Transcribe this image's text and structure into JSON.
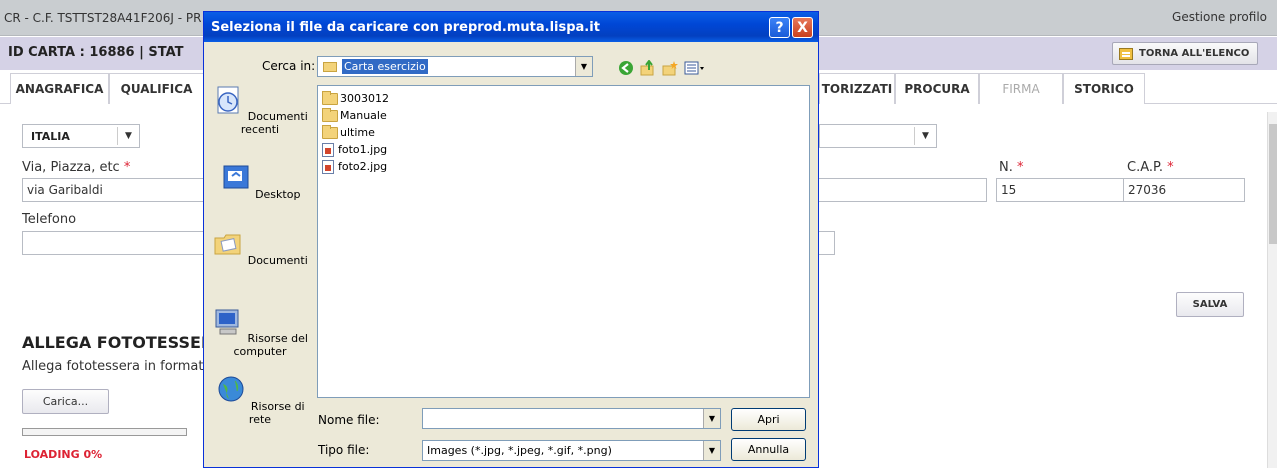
{
  "page": {
    "top_title": "CR - C.F. TSTTST28A41F206J - PR",
    "profile_link": "Gestione profilo",
    "id_bar": "ID CARTA : 16886   |   STAT",
    "back_button": "TORNA ALL'ELENCO",
    "tabs": [
      {
        "label": "ANAGRAFICA",
        "disabled": false
      },
      {
        "label": "QUALIFICA",
        "disabled": false
      },
      {
        "label": "TORIZZATI",
        "disabled": false
      },
      {
        "label": "PROCURA",
        "disabled": false
      },
      {
        "label": "FIRMA",
        "disabled": true
      },
      {
        "label": "STORICO",
        "disabled": false
      }
    ],
    "country_select": "ITALIA",
    "via_label": "Via, Piazza, etc",
    "via_value": "via Garibaldi",
    "numero_label": "N.",
    "numero_value": "15",
    "cap_label": "C.A.P.",
    "cap_value": "27036",
    "telefono_label": "Telefono",
    "telefono_value": "",
    "required_mark": "*",
    "save_button": "SALVA",
    "photo_heading": "ALLEGA FOTOTESSERA",
    "photo_desc": "Allega fototessera in formato",
    "upload_button": "Carica...",
    "loading": "LOADING 0%",
    "progress": 0
  },
  "dialog": {
    "title": "Seleziona il file da caricare con preprod.muta.lispa.it",
    "look_in_label": "Cerca in:",
    "look_in_value": "Carta esercizio",
    "places": [
      "Documenti recenti",
      "Desktop",
      "Documenti",
      "Risorse del computer",
      "Risorse di rete"
    ],
    "files": [
      {
        "name": "3003012",
        "type": "folder"
      },
      {
        "name": "Manuale",
        "type": "folder"
      },
      {
        "name": "ultime",
        "type": "folder"
      },
      {
        "name": "foto1.jpg",
        "type": "jpg"
      },
      {
        "name": "foto2.jpg",
        "type": "jpg"
      }
    ],
    "filename_label": "Nome file:",
    "filename_value": "",
    "filetype_label": "Tipo file:",
    "filetype_value": "Images (*.jpg, *.jpeg, *.gif, *.png)",
    "open_button": "Apri",
    "cancel_button": "Annulla",
    "help_button": "?",
    "close_button": "X"
  }
}
